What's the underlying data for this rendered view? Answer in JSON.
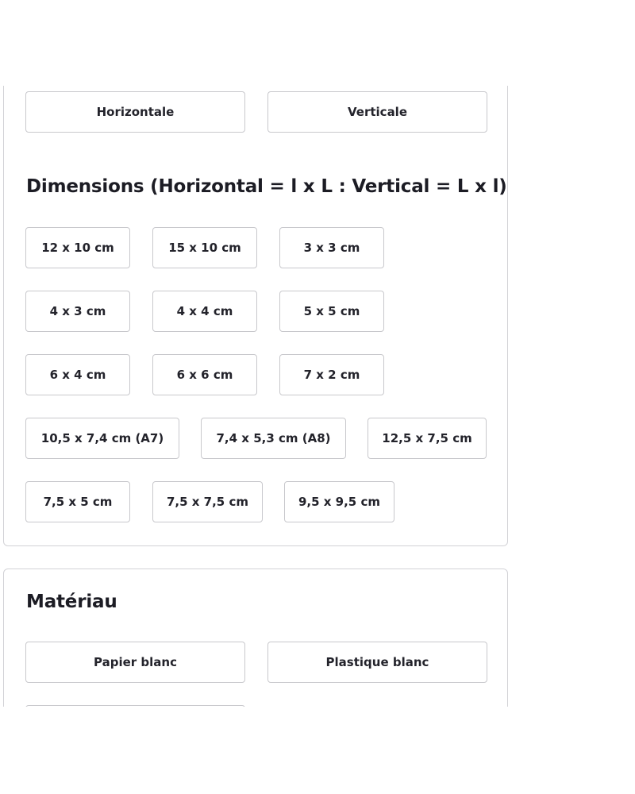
{
  "orientation": {
    "options": [
      "Horizontale",
      "Verticale"
    ]
  },
  "dimensions": {
    "title": "Dimensions (Horizontal = l x L : Vertical = L x l)",
    "options": [
      "12 x 10 cm",
      "15 x 10 cm",
      "3 x 3 cm",
      "4 x 3 cm",
      "4 x 4 cm",
      "5 x 5 cm",
      "6 x 4 cm",
      "6 x 6 cm",
      "7 x 2 cm",
      "10,5 x 7,4 cm (A7)",
      "7,4 x 5,3 cm (A8)",
      "12,5 x 7,5 cm",
      "7,5 x 5 cm",
      "7,5 x 7,5 cm",
      "9,5 x 9,5 cm"
    ]
  },
  "material": {
    "title": "Matériau",
    "options": [
      "Papier blanc",
      "Plastique blanc",
      ""
    ]
  }
}
